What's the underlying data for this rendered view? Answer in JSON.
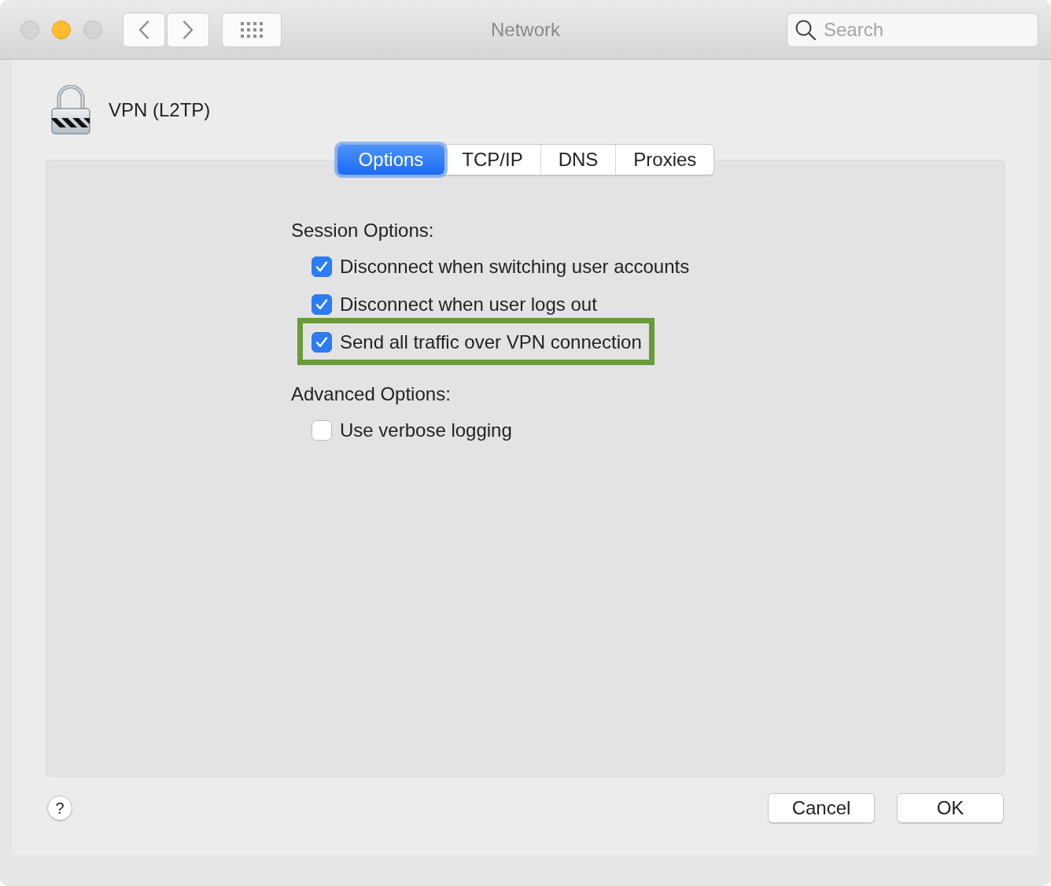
{
  "window": {
    "title": "Network",
    "controls": [
      {
        "kind": "close",
        "disabled": true
      },
      {
        "kind": "minimize",
        "disabled": false
      },
      {
        "kind": "zoom",
        "disabled": true
      }
    ]
  },
  "toolbar": {
    "search": {
      "placeholder": "Search"
    }
  },
  "service": {
    "name": "VPN (L2TP)"
  },
  "tabs": [
    {
      "label": "Options",
      "selected": true
    },
    {
      "label": "TCP/IP",
      "selected": false
    },
    {
      "label": "DNS",
      "selected": false
    },
    {
      "label": "Proxies",
      "selected": false
    }
  ],
  "sections": [
    {
      "heading": "Session Options:",
      "options": [
        {
          "label": "Disconnect when switching user accounts",
          "checked": true,
          "highlighted": false
        },
        {
          "label": "Disconnect when user logs out",
          "checked": true,
          "highlighted": false
        },
        {
          "label": "Send all traffic over VPN connection",
          "checked": true,
          "highlighted": true
        }
      ]
    },
    {
      "heading": "Advanced Options:",
      "options": [
        {
          "label": "Use verbose logging",
          "checked": false,
          "highlighted": false
        }
      ]
    }
  ],
  "footer": {
    "help": "?",
    "buttons": [
      "Cancel",
      "OK"
    ]
  }
}
